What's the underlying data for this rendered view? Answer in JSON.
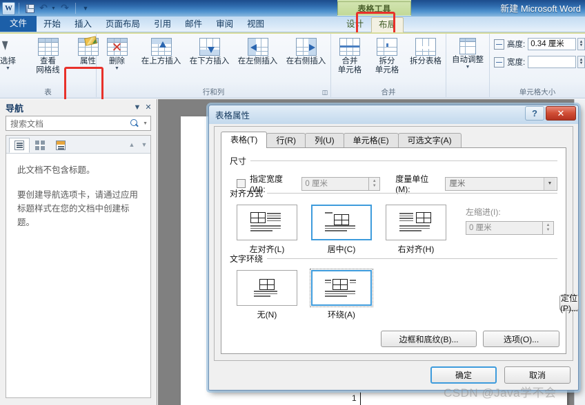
{
  "titlebar": {
    "app_icon": "word-icon",
    "quick_access": [
      {
        "name": "save-icon",
        "label": "保存"
      },
      {
        "name": "undo-icon",
        "label": "撤消"
      },
      {
        "name": "redo-icon",
        "label": "恢复"
      },
      {
        "name": "customize-qat-icon",
        "label": "自定义快速访问工具栏"
      }
    ],
    "document_title": "新建 Microsoft Word"
  },
  "context_label": "表格工具",
  "tabs": [
    {
      "label": "文件",
      "id": "file"
    },
    {
      "label": "开始",
      "id": "home"
    },
    {
      "label": "插入",
      "id": "insert"
    },
    {
      "label": "页面布局",
      "id": "page-layout"
    },
    {
      "label": "引用",
      "id": "references"
    },
    {
      "label": "邮件",
      "id": "mailings"
    },
    {
      "label": "审阅",
      "id": "review"
    },
    {
      "label": "视图",
      "id": "view"
    },
    {
      "label": "设计",
      "id": "design"
    },
    {
      "label": "布局",
      "id": "layout"
    }
  ],
  "ribbon": {
    "groups": [
      {
        "title": "表",
        "buttons": [
          {
            "label": "选择",
            "icon": "select-cursor-icon",
            "has_caret": true
          },
          {
            "label": "查看\n网格线",
            "line1": "查看",
            "line2": "网格线",
            "icon": "view-gridlines-icon",
            "has_caret": false
          },
          {
            "label": "属性",
            "icon": "table-properties-icon",
            "has_caret": false,
            "highlighted": true
          }
        ]
      },
      {
        "title": "行和列",
        "buttons": [
          {
            "label": "删除",
            "icon": "delete-table-icon",
            "has_caret": true
          },
          {
            "label": "在上方插入",
            "icon": "insert-above-icon",
            "has_caret": false
          },
          {
            "label": "在下方插入",
            "icon": "insert-below-icon",
            "has_caret": false
          },
          {
            "label": "在左侧插入",
            "icon": "insert-left-icon",
            "has_caret": false
          },
          {
            "label": "在右侧插入",
            "icon": "insert-right-icon",
            "has_caret": false
          }
        ]
      },
      {
        "title": "合并",
        "buttons": [
          {
            "line1": "合并",
            "line2": "单元格",
            "icon": "merge-cells-icon",
            "has_caret": false
          },
          {
            "line1": "拆分",
            "line2": "单元格",
            "icon": "split-cells-icon",
            "has_caret": false
          },
          {
            "line1": "拆分表格",
            "line2": "",
            "icon": "split-table-icon",
            "has_caret": false
          }
        ]
      },
      {
        "title": "",
        "buttons": [
          {
            "line1": "自动调整",
            "line2": "",
            "icon": "autofit-icon",
            "has_caret": true
          }
        ]
      }
    ],
    "cell_size": {
      "title": "单元格大小",
      "height_label": "高度:",
      "height_value": "0.34 厘米",
      "width_label": "宽度:",
      "width_value": ""
    }
  },
  "navigation": {
    "title": "导航",
    "dropdown_icon": "chevron-down-icon",
    "close_icon": "close-icon",
    "search_placeholder": "搜索文档",
    "search_value": "",
    "search_icon": "search-icon",
    "tabs": [
      {
        "name": "headings-tab",
        "icon": "headings-icon"
      },
      {
        "name": "pages-tab",
        "icon": "pages-thumbnail-icon"
      },
      {
        "name": "results-tab",
        "icon": "search-results-icon"
      }
    ],
    "prev_icon": "arrow-up-icon",
    "next_icon": "arrow-down-icon",
    "message_1": "此文档不包含标题。",
    "message_2": "要创建导航选项卡，请通过应用标题样式在您的文档中创建标题。"
  },
  "document": {
    "cell_marker": "1"
  },
  "dialog": {
    "title": "表格属性",
    "help_icon": "help-icon",
    "close_icon": "close-icon",
    "tabs": [
      {
        "label": "表格(T)",
        "active": true
      },
      {
        "label": "行(R)",
        "active": false
      },
      {
        "label": "列(U)",
        "active": false
      },
      {
        "label": "单元格(E)",
        "active": false
      },
      {
        "label": "可选文字(A)",
        "active": false
      }
    ],
    "size_group": {
      "title": "尺寸",
      "checkbox_label": "指定宽度(W):",
      "checked": false,
      "width_value": "0 厘米",
      "unit_label": "度量单位(M):",
      "unit_value": "厘米"
    },
    "alignment_group": {
      "title": "对齐方式",
      "options": [
        {
          "label": "左对齐(L)",
          "selected": false,
          "icon": "align-left-table-icon"
        },
        {
          "label": "居中(C)",
          "selected": true,
          "icon": "align-center-table-icon"
        },
        {
          "label": "右对齐(H)",
          "selected": false,
          "icon": "align-right-table-icon"
        }
      ],
      "indent_label": "左缩进(I):",
      "indent_value": "0 厘米"
    },
    "wrapping_group": {
      "title": "文字环绕",
      "options": [
        {
          "label": "无(N)",
          "selected": false,
          "icon": "wrap-none-icon"
        },
        {
          "label": "环绕(A)",
          "selected": true,
          "icon": "wrap-around-icon"
        }
      ],
      "position_button": "定位(P)..."
    },
    "borders_button": "边框和底纹(B)...",
    "options_button": "选项(O)...",
    "ok_button": "确定",
    "cancel_button": "取消"
  },
  "watermark": "CSDN @Java学不会",
  "colors": {
    "accent_blue": "#3d9bdc",
    "highlight_red": "#e8312a",
    "title_blue": "#1c4c8c",
    "context_green": "#c2d998"
  }
}
